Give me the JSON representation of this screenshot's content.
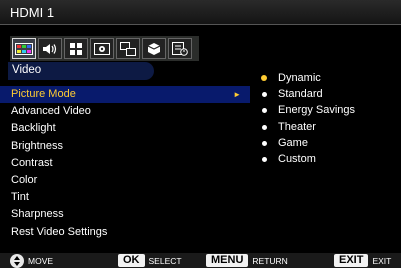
{
  "title": "HDMI 1",
  "tabs": [
    {
      "name": "picture-icon",
      "active": true
    },
    {
      "name": "audio-icon"
    },
    {
      "name": "apps-icon"
    },
    {
      "name": "settings-icon"
    },
    {
      "name": "network-icon"
    },
    {
      "name": "3d-icon"
    },
    {
      "name": "timer-icon"
    }
  ],
  "section": "Video",
  "menu": [
    "Picture Mode",
    "Advanced Video",
    "Backlight",
    "Brightness",
    "Contrast",
    "Color",
    "Tint",
    "Sharpness",
    "Rest Video Settings"
  ],
  "menu_active_arrow": "►",
  "options": [
    "Dynamic",
    "Standard",
    "Energy Savings",
    "Theater",
    "Game",
    "Custom"
  ],
  "selected_option": "Dynamic",
  "footer": {
    "move": "MOVE",
    "ok_key": "OK",
    "ok_label": "SELECT",
    "menu_key": "MENU",
    "menu_label": "RETURN",
    "exit_key": "EXIT",
    "exit_label": "EXIT"
  },
  "colors": {
    "highlight_bg": "#081a6c",
    "highlight_text": "#ffcc33"
  }
}
